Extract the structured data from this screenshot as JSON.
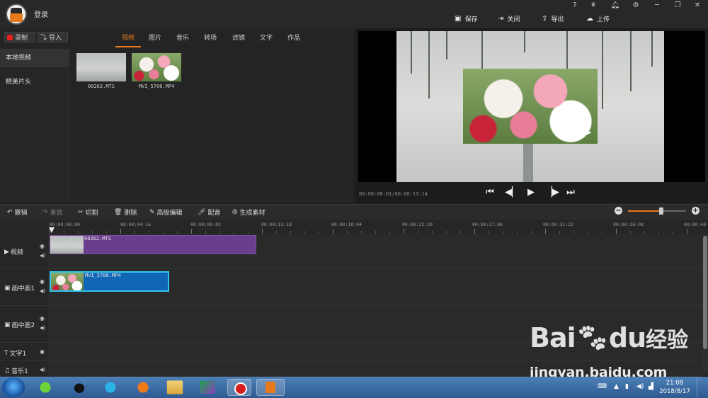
{
  "app": {
    "login_label": "登录",
    "window_controls": [
      "?",
      "VIP",
      "bell",
      "gear",
      "minimize",
      "restore",
      "close"
    ],
    "actions": {
      "save": "保存",
      "close": "关闭",
      "export": "导出",
      "upload": "上传"
    }
  },
  "media": {
    "record_label": "录制",
    "import_label": "导入",
    "tabs": [
      "视频",
      "图片",
      "音乐",
      "转场",
      "滤镜",
      "文字",
      "作品"
    ],
    "active_tab": "视频",
    "sidebar": [
      "本地视频",
      "精美片头"
    ],
    "files": [
      "00262.MTS",
      "MVI_5700.MP4"
    ]
  },
  "preview": {
    "timecode": "00:00:00:01/00:00:13:14",
    "controls": [
      "skip-start",
      "prev-frame",
      "play",
      "next-frame",
      "skip-end"
    ]
  },
  "toolbar": {
    "undo": "撤销",
    "redo": "重做",
    "cut": "切割",
    "delete": "删除",
    "advanced_edit": "高级编辑",
    "dub": "配音",
    "generate": "生成素材",
    "zoom_level": 0.57
  },
  "ruler": {
    "labels": [
      "00:00:00:00",
      "00:00:04:16",
      "00:00:09:02",
      "00:00:13:18",
      "00:00:18:04",
      "00:00:22:20",
      "00:00:27:06",
      "00:00:31:22",
      "00:00:36:08",
      "00:00:40"
    ]
  },
  "tracks": {
    "video": "视频",
    "pip1": "画中画1",
    "pip2": "画中画2",
    "text1": "文字1",
    "music1": "音乐1",
    "clip_video": "00262.MTS",
    "clip_pip": "MVI_5700.MP4"
  },
  "watermark": {
    "logo": "Bai",
    "logo2": "du",
    "cn": "经验",
    "url": "jingyan.baidu.com"
  },
  "taskbar": {
    "time": "21:08",
    "date": "2018/8/17"
  }
}
